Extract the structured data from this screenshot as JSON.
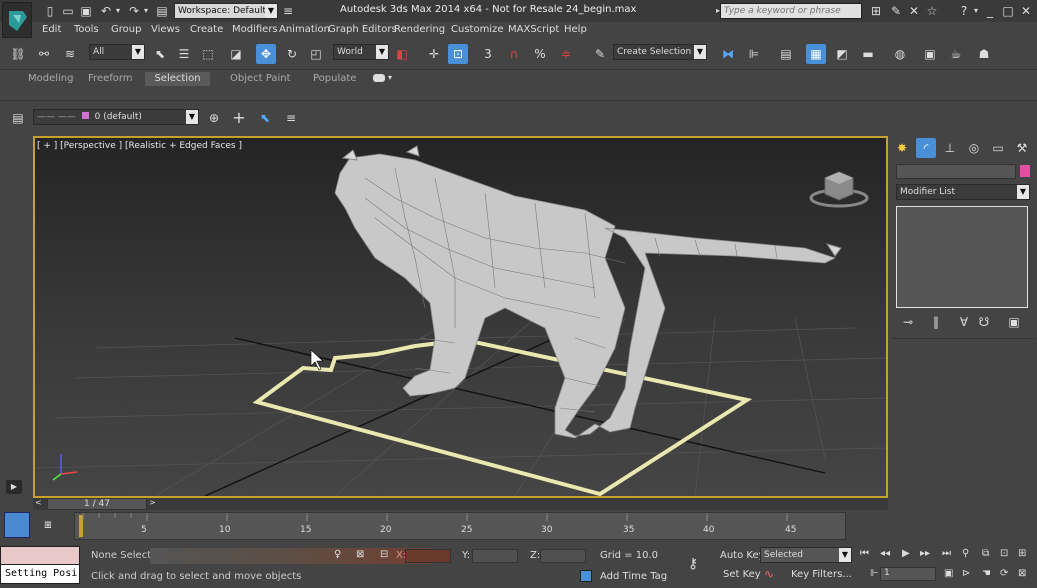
{
  "titlebar": {
    "workspace": "Workspace: Default",
    "title": "Autodesk 3ds Max  2014 x64  - Not for Resale   24_begin.max",
    "search_placeholder": "Type a keyword or phrase"
  },
  "menu": [
    "Edit",
    "Tools",
    "Group",
    "Views",
    "Create",
    "Modifiers",
    "Animation",
    "Graph Editors",
    "Rendering",
    "Customize",
    "MAXScript",
    "Help"
  ],
  "toolbar": {
    "filter": "All",
    "coord_system": "World",
    "snap_angle": "3",
    "snap_percent": "%",
    "selection_set": "Create Selection Se"
  },
  "ribbon_tabs": [
    "Modeling",
    "Freeform",
    "Selection",
    "Object Paint",
    "Populate"
  ],
  "layer_bar": {
    "layer": "0 (default)"
  },
  "viewport": {
    "label": "[ + ] [Perspective ] [Realistic + Edged Faces ]"
  },
  "command_panel": {
    "modifier_list": "Modifier List"
  },
  "timeline": {
    "frame_counter": "1 / 47",
    "ticks": [
      "5",
      "10",
      "15",
      "20",
      "25",
      "30",
      "35",
      "40",
      "45"
    ]
  },
  "status": {
    "maxscript_listener": "Setting Posi",
    "selection": "None Selected",
    "prompt": "Click and drag to select and move objects",
    "x_label": "X:",
    "y_label": "Y:",
    "z_label": "Z:",
    "grid": "Grid = 10.0",
    "add_time_tag": "Add Time Tag",
    "auto_key": "Auto Key",
    "set_key": "Set Key",
    "key_mode": "Selected",
    "key_filters": "Key Filters...",
    "current_frame": "1"
  },
  "colors": {
    "accent": "#4a90d9",
    "selection_outline": "#e8e8b0",
    "viewport_border": "#c8a030",
    "object_color": "#e050a0"
  }
}
